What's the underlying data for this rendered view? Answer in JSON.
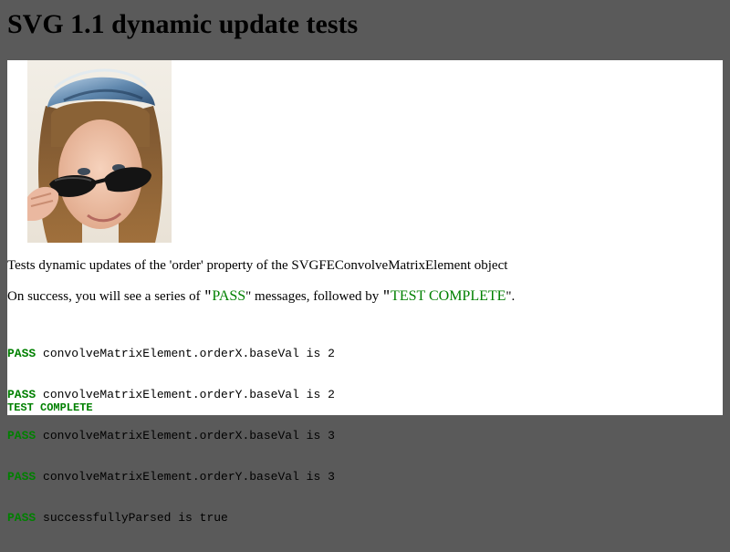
{
  "page": {
    "title": "SVG 1.1 dynamic update tests"
  },
  "test": {
    "description": "Tests dynamic updates of the 'order' property of the SVGFEConvolveMatrixElement object",
    "success_prefix": "On success, you will see a series of ",
    "success_quote_open": "\"",
    "pass_word": "PASS",
    "success_mid": "\" messages, followed by ",
    "complete_word": "TEST COMPLETE",
    "success_suffix": "\".",
    "results": [
      {
        "status": "PASS",
        "message": " convolveMatrixElement.orderX.baseVal is 2"
      },
      {
        "status": "PASS",
        "message": " convolveMatrixElement.orderY.baseVal is 2"
      },
      {
        "status": "PASS",
        "message": " convolveMatrixElement.orderX.baseVal is 3"
      },
      {
        "status": "PASS",
        "message": " convolveMatrixElement.orderY.baseVal is 3"
      },
      {
        "status": "PASS",
        "message": " successfullyParsed is true"
      }
    ],
    "final_status": "TEST COMPLETE"
  },
  "image": {
    "subject": "woman-with-sunglasses-photo"
  },
  "colors": {
    "background": "#5a5a5a",
    "panel": "#ffffff",
    "pass_green": "#008000"
  }
}
